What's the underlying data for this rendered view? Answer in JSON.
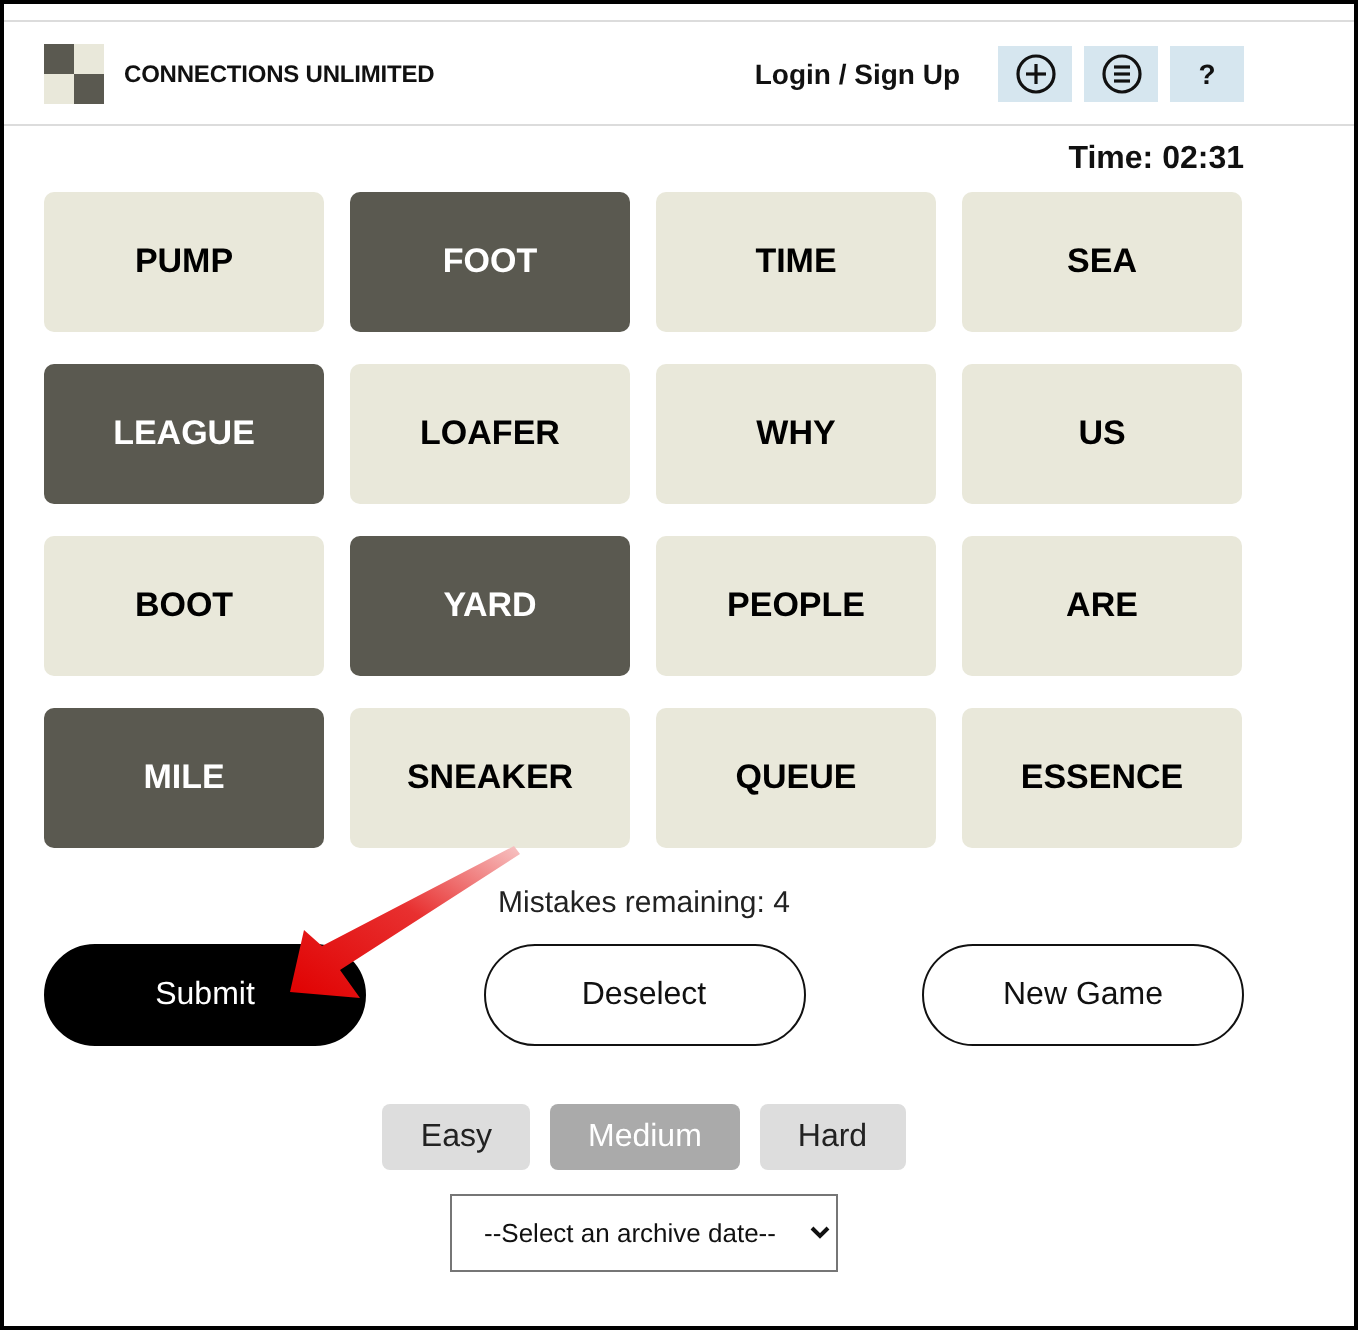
{
  "header": {
    "title": "CONNECTIONS UNLIMITED",
    "login": "Login / Sign Up",
    "buttons": [
      {
        "kind": "add"
      },
      {
        "kind": "menu"
      },
      {
        "kind": "help",
        "label": "?"
      }
    ]
  },
  "timer": "Time: 02:31",
  "tiles": [
    {
      "word": "PUMP",
      "selected": false
    },
    {
      "word": "FOOT",
      "selected": true
    },
    {
      "word": "TIME",
      "selected": false
    },
    {
      "word": "SEA",
      "selected": false
    },
    {
      "word": "LEAGUE",
      "selected": true
    },
    {
      "word": "LOAFER",
      "selected": false
    },
    {
      "word": "WHY",
      "selected": false
    },
    {
      "word": "US",
      "selected": false
    },
    {
      "word": "BOOT",
      "selected": false
    },
    {
      "word": "YARD",
      "selected": true
    },
    {
      "word": "PEOPLE",
      "selected": false
    },
    {
      "word": "ARE",
      "selected": false
    },
    {
      "word": "MILE",
      "selected": true
    },
    {
      "word": "SNEAKER",
      "selected": false
    },
    {
      "word": "QUEUE",
      "selected": false
    },
    {
      "word": "ESSENCE",
      "selected": false
    }
  ],
  "mistakes": "Mistakes remaining: 4",
  "actions": [
    {
      "label": "Submit",
      "kind": "filled"
    },
    {
      "label": "Deselect",
      "kind": "outline"
    },
    {
      "label": "New Game",
      "kind": "outline"
    }
  ],
  "difficulty": [
    {
      "label": "Easy",
      "selected": false
    },
    {
      "label": "Medium",
      "selected": true
    },
    {
      "label": "Hard",
      "selected": false
    }
  ],
  "archive_select": {
    "value": "--Select an archive date--"
  }
}
